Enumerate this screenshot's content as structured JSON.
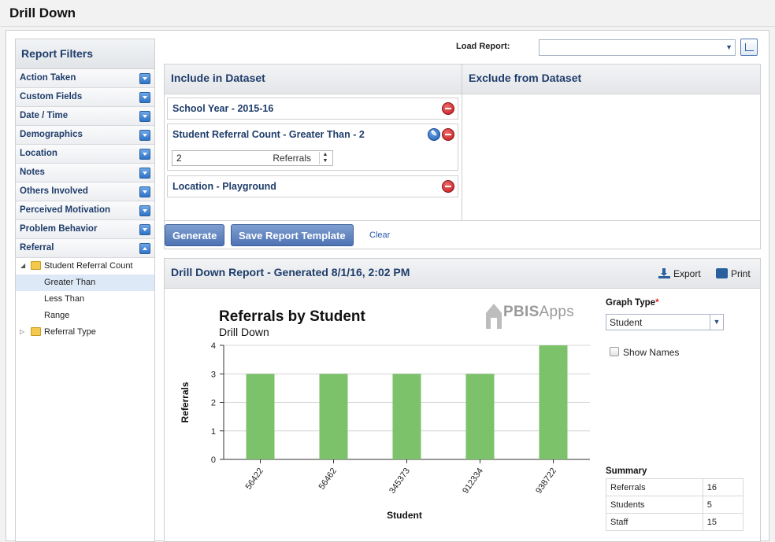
{
  "app": {
    "title": "Drill Down"
  },
  "sidebar": {
    "header": "Report Filters",
    "items": [
      {
        "label": "Action Taken"
      },
      {
        "label": "Custom Fields"
      },
      {
        "label": "Date / Time"
      },
      {
        "label": "Demographics"
      },
      {
        "label": "Location"
      },
      {
        "label": "Notes"
      },
      {
        "label": "Others Involved"
      },
      {
        "label": "Perceived Motivation"
      },
      {
        "label": "Problem Behavior"
      },
      {
        "label": "Referral"
      }
    ],
    "tree": {
      "student_referral_count": "Student Referral Count",
      "greater_than": "Greater Than",
      "less_than": "Less Than",
      "range": "Range",
      "referral_type": "Referral Type"
    }
  },
  "load_report": {
    "label": "Load Report:",
    "value": ""
  },
  "include": {
    "header": "Include in Dataset",
    "criteria": [
      {
        "title": "School Year - 2015-16"
      },
      {
        "title": "Student Referral Count - Greater Than - 2",
        "input_value": "2",
        "unit": "Referrals"
      },
      {
        "title": "Location - Playground"
      }
    ]
  },
  "exclude": {
    "header": "Exclude from Dataset"
  },
  "buttons": {
    "generate": "Generate",
    "save_template": "Save Report Template",
    "clear": "Clear"
  },
  "report": {
    "header": "Drill Down Report - Generated 8/1/16, 2:02 PM",
    "export": "Export",
    "print": "Print",
    "logo": {
      "part1": "PBIS",
      "part2": "Apps"
    },
    "graph_type_label": "Graph Type",
    "required_mark": "*",
    "graph_type_value": "Student",
    "show_names_label": "Show Names",
    "summary_title": "Summary",
    "summary_rows": [
      {
        "label": "Referrals",
        "value": "16"
      },
      {
        "label": "Students",
        "value": "5"
      },
      {
        "label": "Staff",
        "value": "15"
      }
    ]
  },
  "chart_data": {
    "type": "bar",
    "title": "Referrals by Student",
    "subtitle": "Drill Down",
    "xlabel": "Student",
    "ylabel": "Referrals",
    "categories": [
      "56422",
      "56462",
      "345373",
      "912334",
      "938722"
    ],
    "values": [
      3,
      3,
      3,
      3,
      4
    ],
    "ylim": [
      0,
      4
    ],
    "yticks": [
      0,
      1,
      2,
      3,
      4
    ],
    "bar_color": "#7cc26b",
    "grid": true
  }
}
